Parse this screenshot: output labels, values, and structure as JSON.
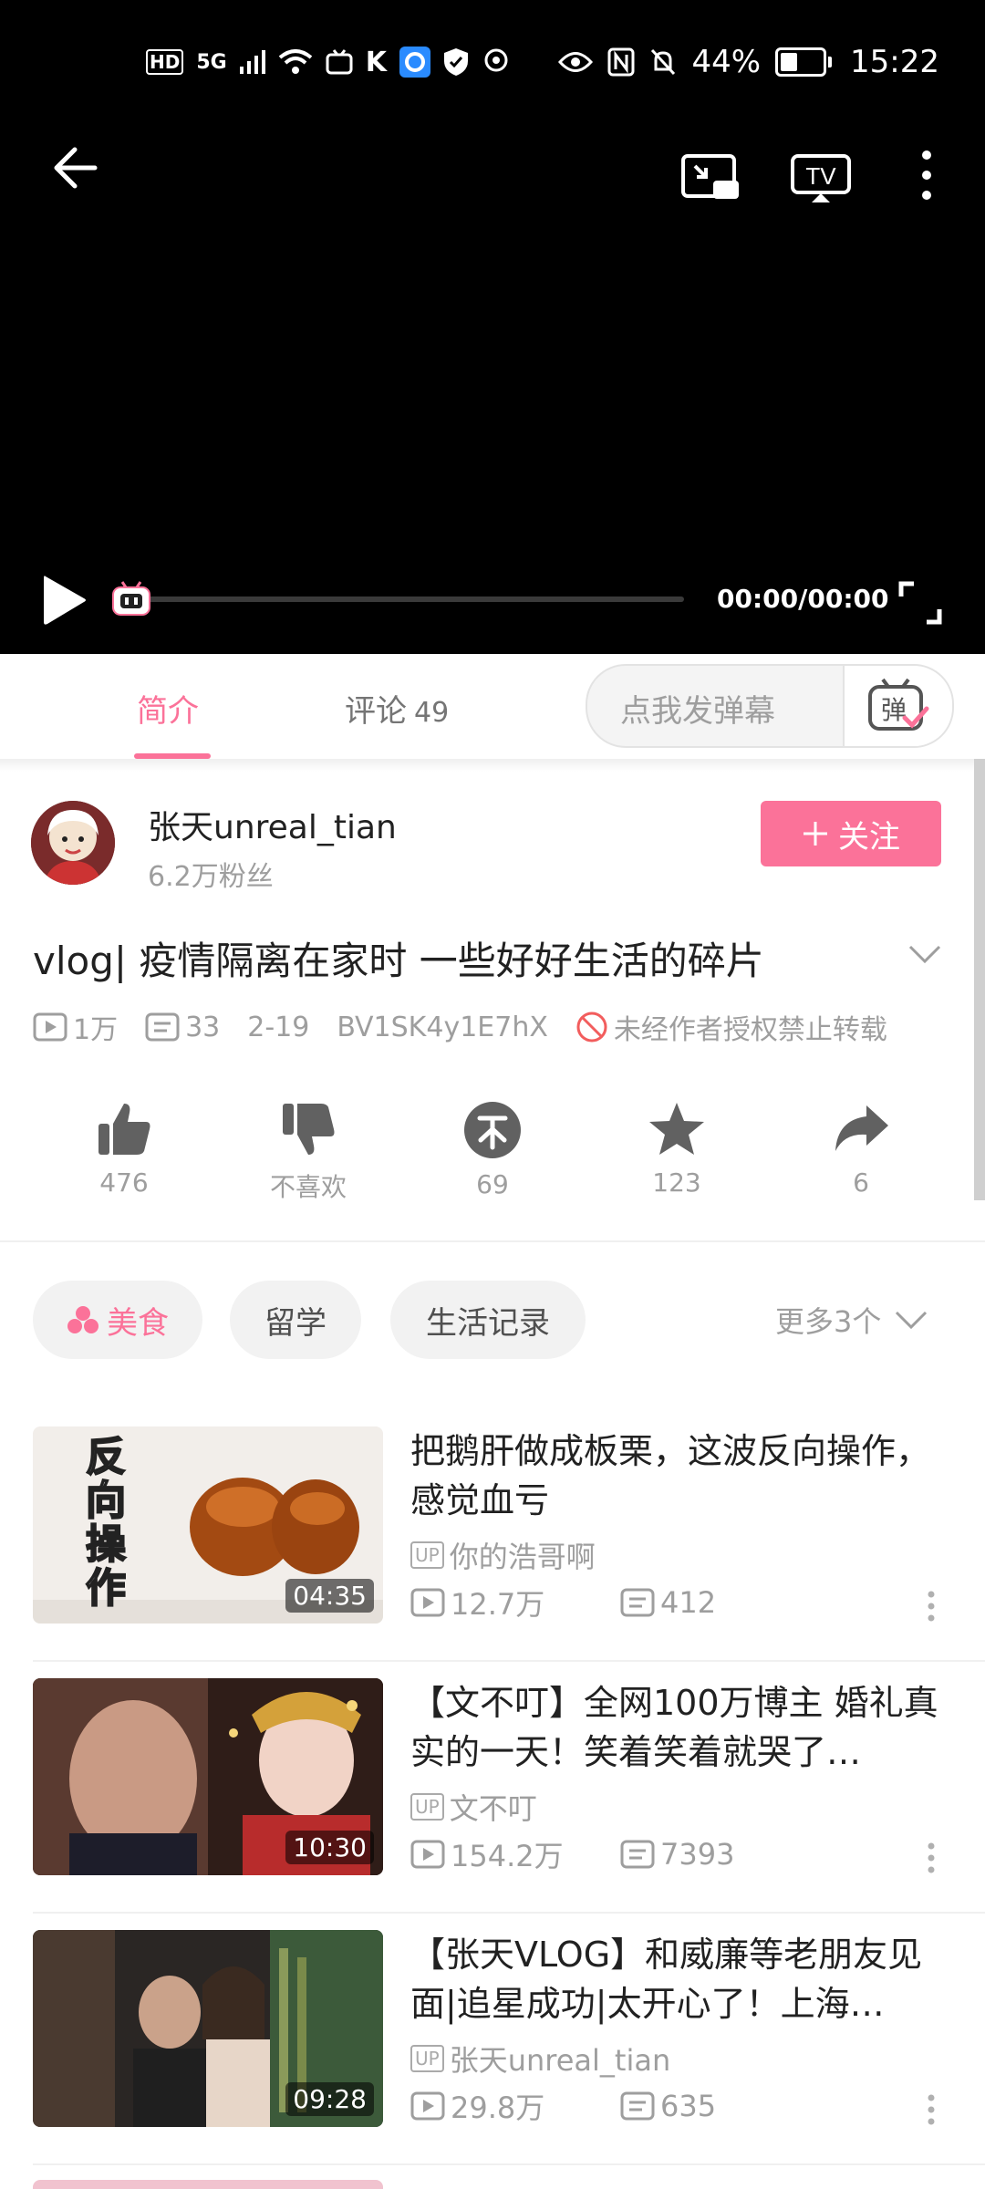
{
  "status_bar": {
    "left_icons": [
      "HD",
      "5G",
      "signal-icon",
      "wifi-icon",
      "bilibili-icon",
      "k-icon",
      "browser-icon",
      "shield-icon",
      "hotspot-icon"
    ],
    "battery": "44%",
    "time": "15:22"
  },
  "player": {
    "time": "00:00/00:00"
  },
  "tabs": {
    "intro": "简介",
    "comments": "评论",
    "comments_count": "49",
    "danmaku_placeholder": "点我发弹幕",
    "danmaku_icon_char": "弹"
  },
  "uploader": {
    "name": "张天unreal_tian",
    "fans": "6.2万粉丝",
    "follow_label": "关注"
  },
  "video": {
    "title": "vlog| 疫情隔离在家时  一些好好生活的碎片",
    "views": "1万",
    "danmaku": "33",
    "date": "2-19",
    "bvid": "BV1SK4y1E7hX",
    "copyright": "未经作者授权禁止转载"
  },
  "actions": [
    {
      "icon": "thumbs-up-icon",
      "label": "476"
    },
    {
      "icon": "thumbs-down-icon",
      "label": "不喜欢"
    },
    {
      "icon": "coin-icon",
      "label": "69"
    },
    {
      "icon": "star-icon",
      "label": "123"
    },
    {
      "icon": "share-icon",
      "label": "6"
    }
  ],
  "tags": [
    "美食",
    "留学",
    "生活记录"
  ],
  "tags_more": "更多3个",
  "related": [
    {
      "title": "把鹅肝做成板栗，这波反向操作，感觉血亏",
      "up": "你的浩哥啊",
      "views": "12.7万",
      "danmaku": "412",
      "duration": "04:35",
      "thumb_text": "反向操作"
    },
    {
      "title": "【文不叮】全网100万博主 婚礼真实的一天！笑着笑着就哭了…",
      "up": "文不叮",
      "views": "154.2万",
      "danmaku": "7393",
      "duration": "10:30"
    },
    {
      "title": "【张天VLOG】和威廉等老朋友见面|追星成功|太开心了！上海…",
      "up": "张天unreal_tian",
      "views": "29.8万",
      "danmaku": "635",
      "duration": "09:28"
    }
  ],
  "colors": {
    "accent": "#fb7299",
    "muted": "#9e9e9e"
  }
}
